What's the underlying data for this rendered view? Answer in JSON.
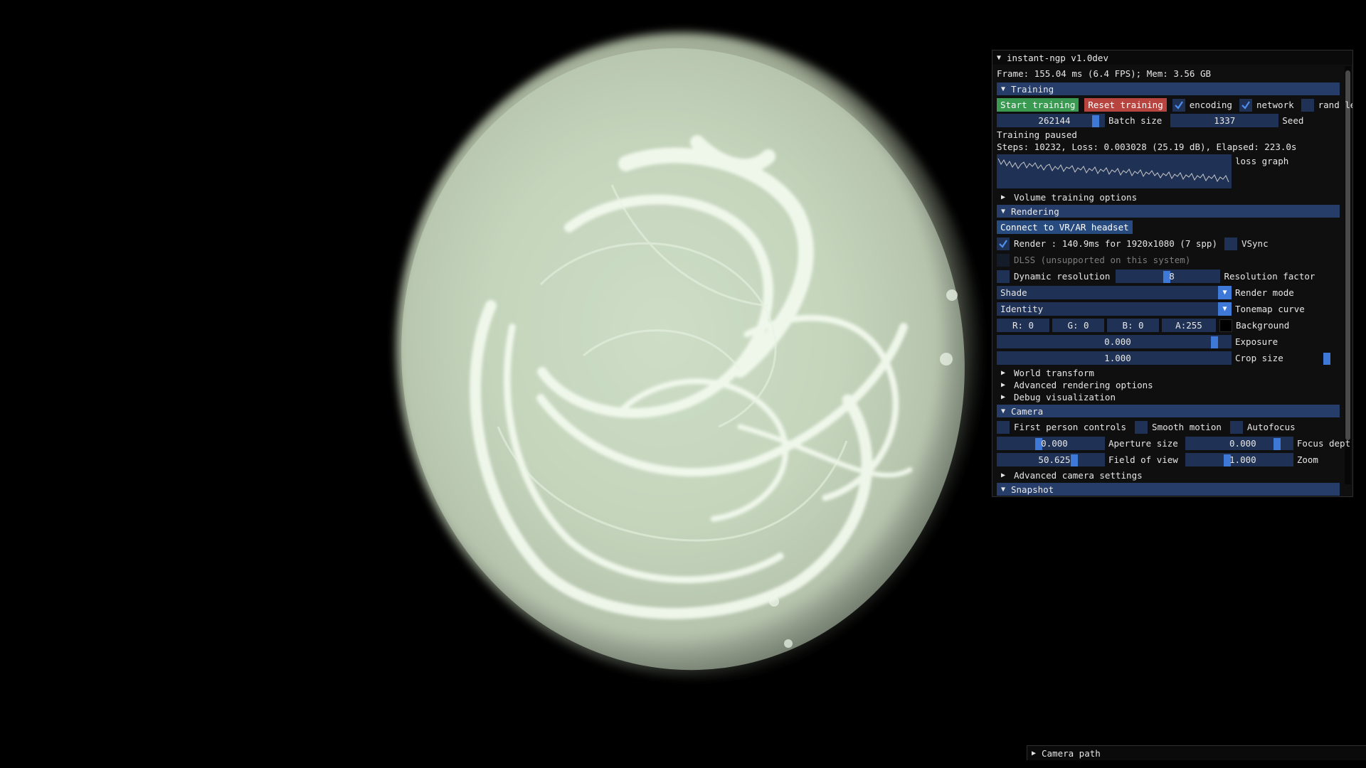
{
  "window": {
    "title": "instant-ngp v1.0dev",
    "frame_info": "Frame: 155.04 ms (6.4 FPS); Mem: 3.56 GB"
  },
  "training": {
    "header": "Training",
    "start_button": "Start training",
    "reset_button": "Reset training",
    "encoding_label": "encoding",
    "encoding_checked": true,
    "network_label": "network",
    "network_checked": true,
    "rand_label": "rand leve",
    "rand_checked": false,
    "batch_size_value": "262144",
    "batch_size_label": "Batch size",
    "seed_value": "1337",
    "seed_label": "Seed",
    "status": "Training paused",
    "steps": "Steps: 10232, Loss: 0.003028 (25.19 dB), Elapsed: 223.0s",
    "loss_graph_label": "loss graph",
    "volume_options": "Volume training options"
  },
  "rendering": {
    "header": "Rendering",
    "vr_button": "Connect to VR/AR headset",
    "render_label": "Render : 140.9ms for 1920x1080 (7 spp)",
    "render_checked": true,
    "vsync_label": "VSync",
    "vsync_checked": false,
    "dlss_label": "DLSS (unsupported on this system)",
    "dynamic_res_label": "Dynamic resolution",
    "dynamic_res_checked": false,
    "resolution_factor_value": "8",
    "resolution_factor_label": "Resolution factor",
    "render_mode_value": "Shade",
    "render_mode_label": "Render mode",
    "tonemap_value": "Identity",
    "tonemap_label": "Tonemap curve",
    "bg_r": "R:  0",
    "bg_g": "G:  0",
    "bg_b": "B:  0",
    "bg_a": "A:255",
    "background_label": "Background",
    "background_color": "#000000",
    "exposure_value": "0.000",
    "exposure_label": "Exposure",
    "crop_value": "1.000",
    "crop_label": "Crop size",
    "world_transform": "World transform",
    "advanced_rendering": "Advanced rendering options",
    "debug_vis": "Debug visualization"
  },
  "camera": {
    "header": "Camera",
    "first_person_label": "First person controls",
    "smooth_motion_label": "Smooth motion",
    "autofocus_label": "Autofocus",
    "aperture_value": "0.000",
    "aperture_label": "Aperture size",
    "focus_value": "0.000",
    "focus_label": "Focus dept",
    "fov_value": "50.625",
    "fov_label": "Field of view",
    "zoom_value": "1.000",
    "zoom_label": "Zoom",
    "advanced_camera": "Advanced camera settings"
  },
  "snapshot": {
    "header": "Snapshot"
  },
  "camera_path": {
    "label": "Camera path"
  },
  "colors": {
    "header_bg": "#263d6a",
    "frame_bg": "#1f3154",
    "accent": "#3e79d8",
    "start_green": "#3a9a52",
    "reset_red": "#b8443f"
  }
}
